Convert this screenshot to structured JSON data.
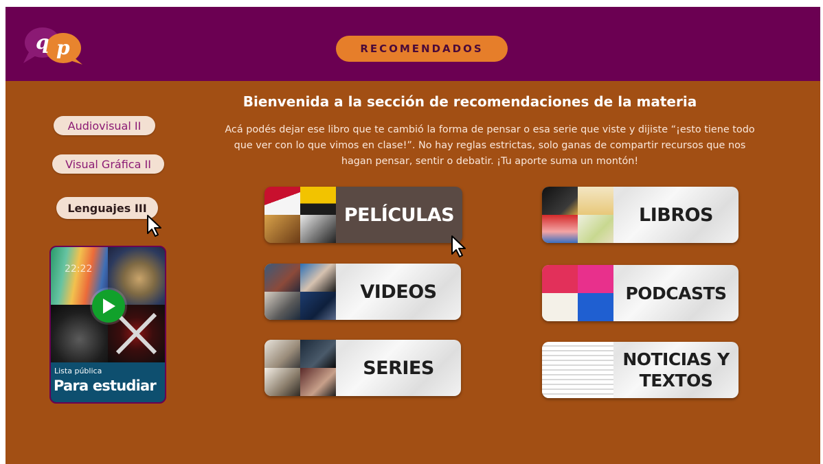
{
  "header": {
    "logo_letters": "qp",
    "recommended_button": "RECOMENDADOS"
  },
  "intro": {
    "title": "Bienvenida a la sección de recomendaciones de la materia",
    "body": "Acá podés dejar ese libro que te cambió la forma de pensar o esa serie que viste y dijiste “¡esto tiene todo que ver con lo que vimos en clase!”. No hay reglas estrictas, solo ganas de compartir recursos que nos hagan pensar, sentir o debatir. ¡Tu aporte suma un montón!"
  },
  "sidebar": {
    "items": [
      {
        "label": "Audiovisual II"
      },
      {
        "label": "Visual Gráfica II"
      },
      {
        "label": "Lenguajes III"
      }
    ]
  },
  "playlist": {
    "time": "22:22",
    "subtitle": "Lista pública",
    "title": "Para estudiar"
  },
  "categories": {
    "peliculas": "PELÍCULAS",
    "videos": "VIDEOS",
    "series": "SERIES",
    "libros": "LIBROS",
    "podcasts": "PODCASTS",
    "noticias": "NOTICIAS Y TEXTOS"
  },
  "colors": {
    "header_bg": "#6b0052",
    "page_bg": "#a24f14",
    "accent": "#e67e2a",
    "pill_text": "#8b1a74"
  }
}
